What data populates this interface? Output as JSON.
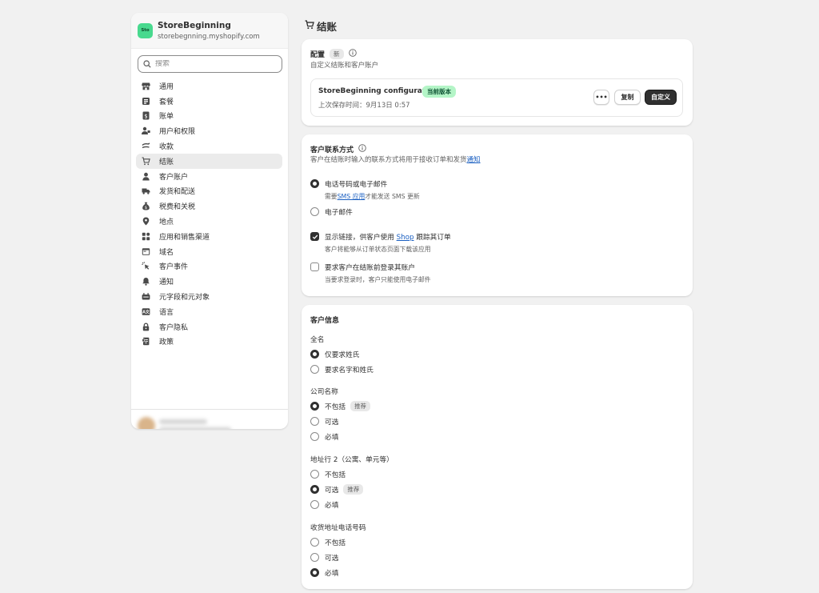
{
  "store": {
    "avatar_text": "Sto",
    "name": "StoreBeginning",
    "domain": "storebegnning.myshopify.com"
  },
  "search": {
    "placeholder": "搜索"
  },
  "sidebar": {
    "items": [
      {
        "label": "通用",
        "icon": "store-icon"
      },
      {
        "label": "套餐",
        "icon": "plan-icon"
      },
      {
        "label": "账单",
        "icon": "billing-icon"
      },
      {
        "label": "用户和权限",
        "icon": "users-icon"
      },
      {
        "label": "收款",
        "icon": "payments-icon"
      },
      {
        "label": "结账",
        "icon": "cart-icon",
        "active": true
      },
      {
        "label": "客户账户",
        "icon": "person-icon"
      },
      {
        "label": "发货和配送",
        "icon": "truck-icon"
      },
      {
        "label": "税费和关税",
        "icon": "tax-icon"
      },
      {
        "label": "地点",
        "icon": "location-icon"
      },
      {
        "label": "应用和销售渠道",
        "icon": "apps-icon"
      },
      {
        "label": "域名",
        "icon": "domain-icon"
      },
      {
        "label": "客户事件",
        "icon": "cursor-icon"
      },
      {
        "label": "通知",
        "icon": "bell-icon"
      },
      {
        "label": "元字段和元对象",
        "icon": "metafields-icon"
      },
      {
        "label": "语言",
        "icon": "language-icon"
      },
      {
        "label": "客户隐私",
        "icon": "lock-icon"
      },
      {
        "label": "政策",
        "icon": "policy-icon"
      }
    ]
  },
  "page": {
    "title": "结账"
  },
  "config_card": {
    "title": "配置",
    "badge": "新",
    "subtitle": "自定义结账和客户账户",
    "config_name": "StoreBeginning configuration",
    "current_badge": "当前版本",
    "saved": "上次保存时间：9月13日 0:57",
    "more_label": "•••",
    "copy_label": "复制",
    "customize_label": "自定义"
  },
  "contact_card": {
    "title": "客户联系方式",
    "desc_prefix": "客户在结账时输入的联系方式将用于接收订单和发货",
    "desc_link": "通知",
    "opt_phone_or_email": "电话号码或电子邮件",
    "help_prefix": "需要",
    "help_link": "SMS 应用",
    "help_suffix": "才能发送 SMS 更新",
    "opt_email": "电子邮件",
    "shop_prefix": "显示链接，供客户使用 ",
    "shop_link": "Shop",
    "shop_suffix": " 跟踪其订单",
    "shop_help": "客户将能够从订单状态页面下载该应用",
    "login_label": "要求客户在结账前登录其账户",
    "login_help": "当要求登录时，客户只能使用电子邮件"
  },
  "info_card": {
    "title": "客户信息",
    "full_name": {
      "title": "全名",
      "options": [
        "仅要求姓氏",
        "要求名字和姓氏"
      ],
      "selected": 0
    },
    "company": {
      "title": "公司名称",
      "options": [
        "不包括",
        "可选",
        "必填"
      ],
      "selected": 0,
      "recommended": "推荐"
    },
    "address2": {
      "title": "地址行 2（公寓、单元等）",
      "options": [
        "不包括",
        "可选",
        "必填"
      ],
      "selected": 1,
      "recommended": "推荐"
    },
    "shipping_phone": {
      "title": "收货地址电话号码",
      "options": [
        "不包括",
        "可选",
        "必填"
      ],
      "selected": 2
    }
  },
  "colors": {
    "background": "#f1f1f1",
    "primary_button": "#303030",
    "current_badge": "#b4f5c7",
    "link": "#1a5fc1",
    "store_avatar": "#48d98e"
  }
}
